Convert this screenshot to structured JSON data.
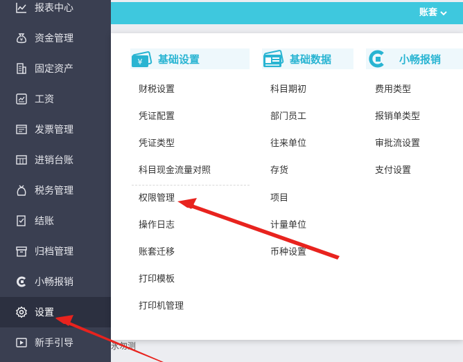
{
  "sidebar": {
    "items": [
      {
        "label": "报表中心",
        "icon": "chart-icon"
      },
      {
        "label": "资金管理",
        "icon": "money-bag-icon"
      },
      {
        "label": "固定资产",
        "icon": "building-icon"
      },
      {
        "label": "工资",
        "icon": "payroll-icon"
      },
      {
        "label": "发票管理",
        "icon": "invoice-icon"
      },
      {
        "label": "进销台账",
        "icon": "ledger-icon"
      },
      {
        "label": "税务管理",
        "icon": "tax-icon"
      },
      {
        "label": "结账",
        "icon": "checkout-icon"
      },
      {
        "label": "归档管理",
        "icon": "archive-icon"
      },
      {
        "label": "小畅报销",
        "icon": "reimburse-logo-icon"
      },
      {
        "label": "设置",
        "icon": "gear-icon"
      },
      {
        "label": "新手引导",
        "icon": "video-guide-icon"
      }
    ],
    "active_index": 10
  },
  "topbar": {
    "account_label": "账套"
  },
  "background": {
    "fragment_text": "氷勿测"
  },
  "panel": {
    "columns": [
      {
        "title": "基础设置",
        "icon": "yuan-card-icon",
        "items": [
          "财税设置",
          "凭证配置",
          "凭证类型",
          "科目现金流量对照",
          "权限管理",
          "操作日志",
          "账套迁移",
          "打印模板",
          "打印机管理"
        ]
      },
      {
        "title": "基础数据",
        "icon": "data-card-icon",
        "items": [
          "科目期初",
          "部门员工",
          "往来单位",
          "存货",
          "项目",
          "计量单位",
          "币种设置"
        ]
      },
      {
        "title": "小畅报销",
        "icon": "reimburse-logo-icon",
        "items": [
          "费用类型",
          "报销单类型",
          "审批流设置",
          "支付设置"
        ]
      }
    ]
  },
  "colors": {
    "sidebar_bg": "#3a3f51",
    "sidebar_active": "#2c3040",
    "topbar": "#3ec8de",
    "accent": "#28b4d2",
    "annotation_arrow": "#e8231e"
  }
}
